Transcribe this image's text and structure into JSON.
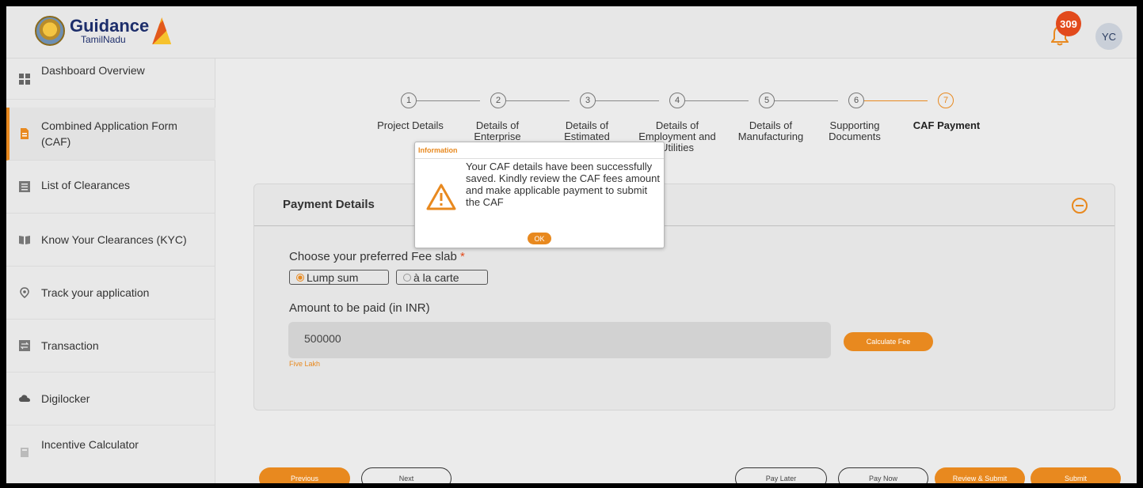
{
  "header": {
    "logo_main": "Guidance",
    "logo_sub": "TamilNadu",
    "notification_count": "309",
    "avatar_initials": "YC"
  },
  "sidebar": {
    "items": [
      {
        "label": "Dashboard Overview",
        "icon": "grid-icon"
      },
      {
        "label": "Combined Application Form (CAF)",
        "icon": "document-icon",
        "active": true
      },
      {
        "label": "List of Clearances",
        "icon": "list-icon"
      },
      {
        "label": "Know Your Clearances (KYC)",
        "icon": "book-icon"
      },
      {
        "label": "Track your application",
        "icon": "location-pin-icon"
      },
      {
        "label": "Transaction",
        "icon": "transaction-icon"
      },
      {
        "label": "Digilocker",
        "icon": "cloud-icon"
      },
      {
        "label": "Incentive Calculator",
        "icon": "calculator-icon"
      }
    ]
  },
  "stepper": {
    "steps": [
      {
        "num": "1",
        "label": "Project Details"
      },
      {
        "num": "2",
        "label": "Details of Enterprise"
      },
      {
        "num": "3",
        "label": "Details of Estimated"
      },
      {
        "num": "4",
        "label": "Details of Employment and Utilities"
      },
      {
        "num": "5",
        "label": "Details of Manufacturing"
      },
      {
        "num": "6",
        "label": "Supporting Documents"
      },
      {
        "num": "7",
        "label": "CAF Payment",
        "active": true
      }
    ]
  },
  "payment": {
    "title": "Payment Details",
    "fee_slab_label": "Choose your preferred Fee slab",
    "required_mark": "*",
    "options": [
      {
        "label": "Lump sum",
        "selected": true
      },
      {
        "label": "à la carte",
        "selected": false
      }
    ],
    "amount_label": "Amount to be paid (in INR)",
    "amount_value": "500000",
    "amount_words": "Five Lakh",
    "calculate_label": "Calculate Fee"
  },
  "footer": {
    "previous": "Previous",
    "next": "Next",
    "pay_later": "Pay Later",
    "pay_now": "Pay Now",
    "review_submit": "Review & Submit",
    "submit": "Submit"
  },
  "modal": {
    "title": "Information",
    "message": "Your CAF details have been successfully saved. Kindly review the CAF fees amount and make applicable payment to submit the CAF",
    "ok": "OK"
  },
  "colors": {
    "accent": "#e8891f",
    "badge": "#e24a1c"
  }
}
